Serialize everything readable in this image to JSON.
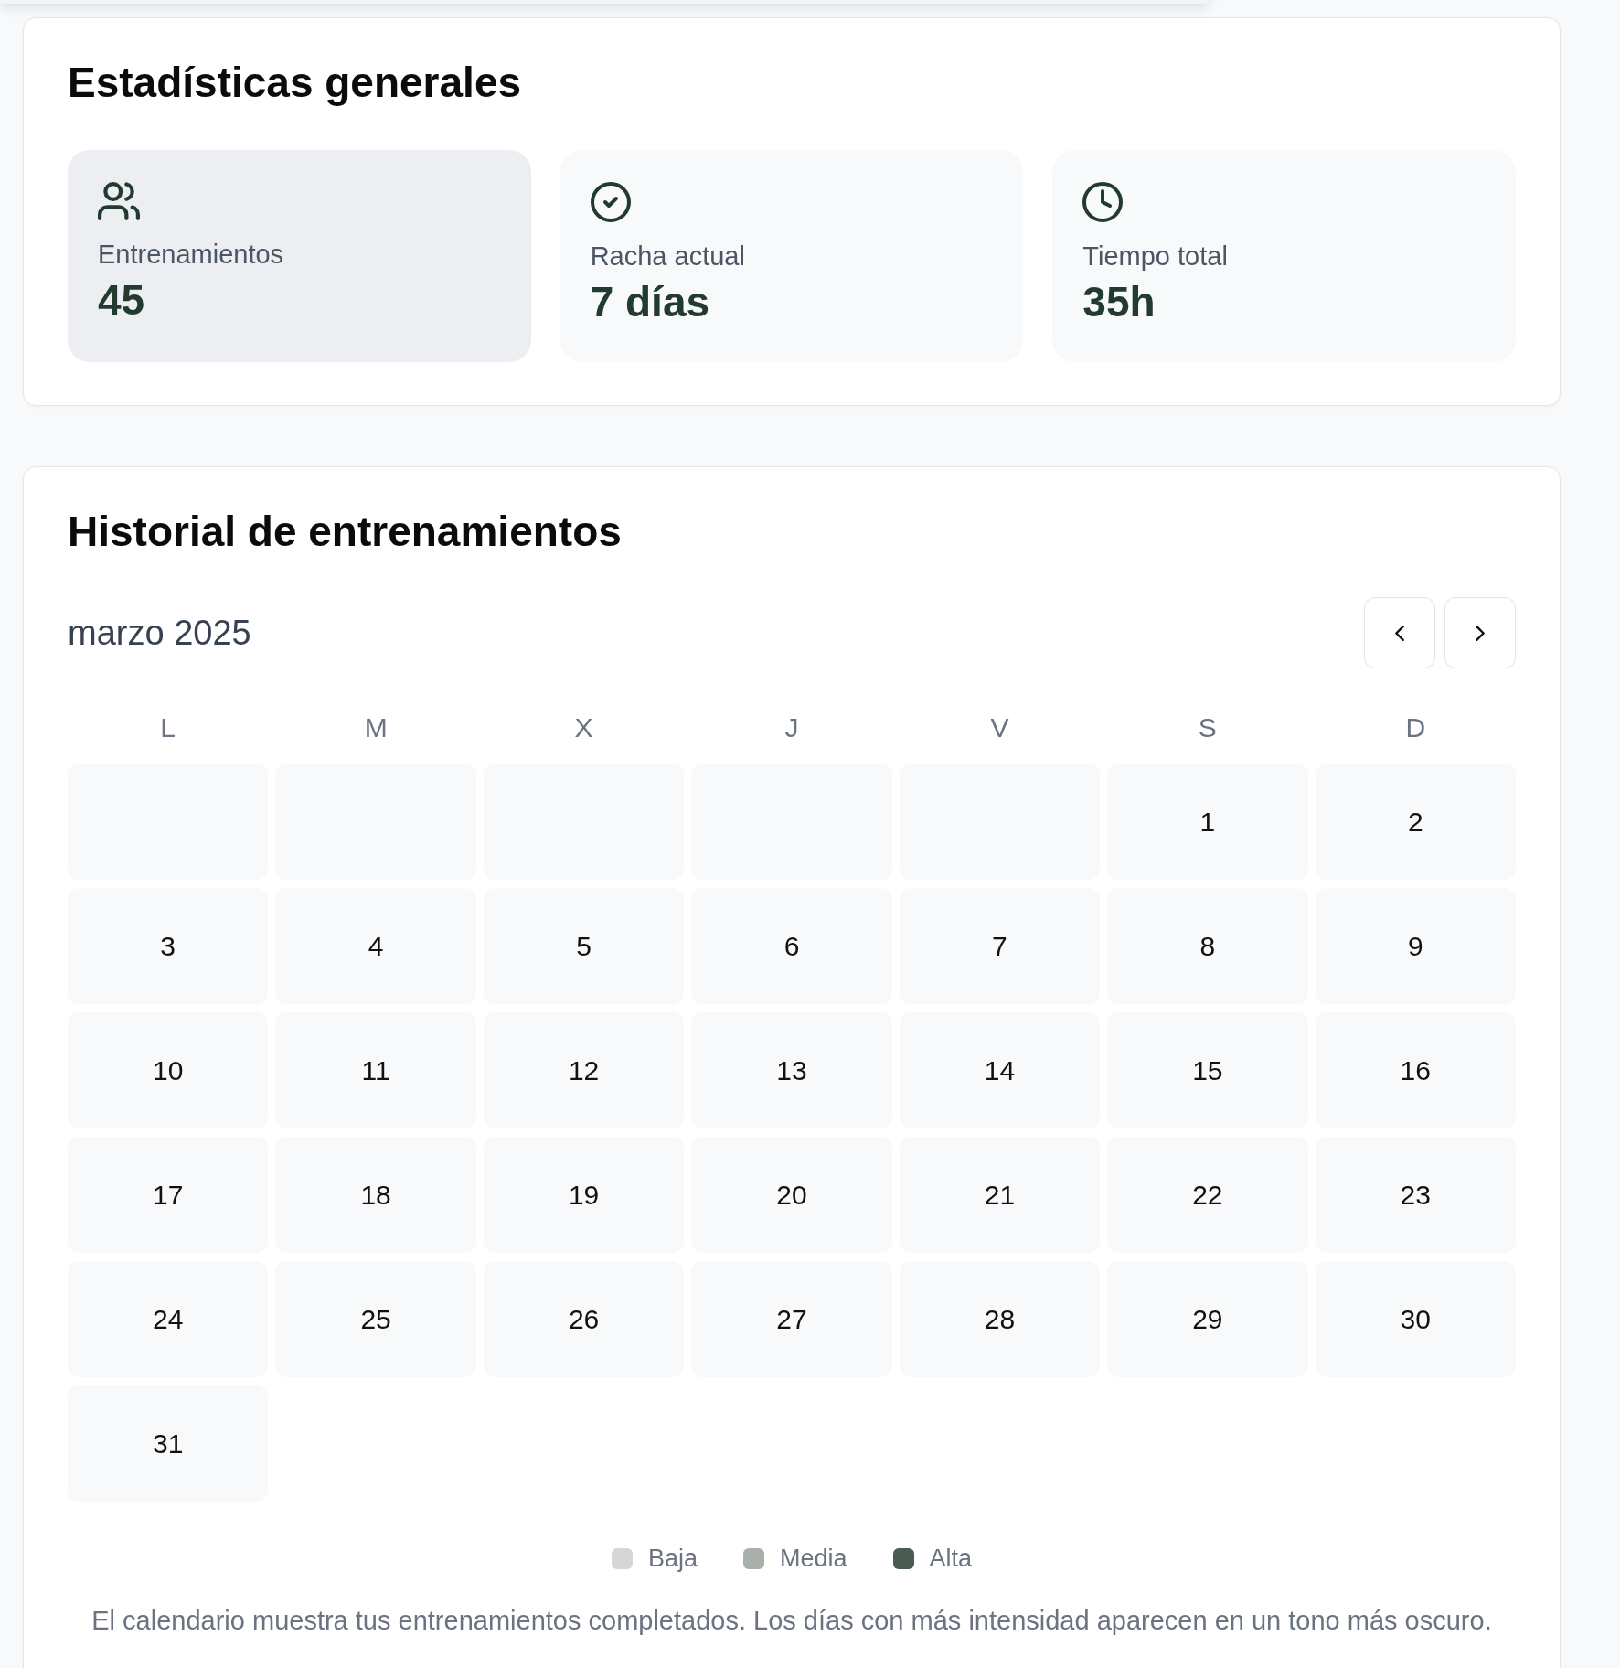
{
  "stats_panel": {
    "title": "Estadísticas generales",
    "cards": [
      {
        "kind": "users",
        "label": "Entrenamientos",
        "value": "45",
        "hovered": true
      },
      {
        "kind": "check-circle",
        "label": "Racha actual",
        "value": "7 días",
        "hovered": false
      },
      {
        "kind": "clock",
        "label": "Tiempo total",
        "value": "35h",
        "hovered": false
      }
    ]
  },
  "history_panel": {
    "title": "Historial de entrenamientos",
    "calendar": {
      "month": "marzo 2025",
      "nav_buttons": [
        {
          "kind": "previous"
        },
        {
          "kind": "next"
        }
      ],
      "weekdays": [
        "L",
        "M",
        "X",
        "J",
        "V",
        "S",
        "D"
      ],
      "weeks": [
        [
          {
            "kind": "blank"
          },
          {
            "kind": "blank"
          },
          {
            "kind": "blank"
          },
          {
            "kind": "blank"
          },
          {
            "kind": "blank"
          },
          {
            "kind": "day",
            "label": "1"
          },
          {
            "kind": "day",
            "label": "2"
          }
        ],
        [
          {
            "kind": "day",
            "label": "3"
          },
          {
            "kind": "day",
            "label": "4"
          },
          {
            "kind": "day",
            "label": "5"
          },
          {
            "kind": "day",
            "label": "6"
          },
          {
            "kind": "day",
            "label": "7"
          },
          {
            "kind": "day",
            "label": "8"
          },
          {
            "kind": "day",
            "label": "9"
          }
        ],
        [
          {
            "kind": "day",
            "label": "10"
          },
          {
            "kind": "day",
            "label": "11"
          },
          {
            "kind": "day",
            "label": "12"
          },
          {
            "kind": "day",
            "label": "13"
          },
          {
            "kind": "day",
            "label": "14"
          },
          {
            "kind": "day",
            "label": "15"
          },
          {
            "kind": "day",
            "label": "16"
          }
        ],
        [
          {
            "kind": "day",
            "label": "17"
          },
          {
            "kind": "day",
            "label": "18"
          },
          {
            "kind": "day",
            "label": "19"
          },
          {
            "kind": "day",
            "label": "20"
          },
          {
            "kind": "day",
            "label": "21"
          },
          {
            "kind": "day",
            "label": "22"
          },
          {
            "kind": "day",
            "label": "23"
          }
        ],
        [
          {
            "kind": "day",
            "label": "24"
          },
          {
            "kind": "day",
            "label": "25"
          },
          {
            "kind": "day",
            "label": "26"
          },
          {
            "kind": "day",
            "label": "27"
          },
          {
            "kind": "day",
            "label": "28"
          },
          {
            "kind": "day",
            "label": "29"
          },
          {
            "kind": "day",
            "label": "30"
          }
        ],
        [
          {
            "kind": "day",
            "label": "31"
          }
        ]
      ]
    },
    "legend": [
      {
        "label": "Baja",
        "color": "#d6d6d6"
      },
      {
        "label": "Media",
        "color": "#a9afa9"
      },
      {
        "label": "Alta",
        "color": "#4c5b51"
      }
    ],
    "note": "El calendario muestra tus entrenamientos completados. Los días con más intensidad aparecen en un tono más oscuro."
  }
}
